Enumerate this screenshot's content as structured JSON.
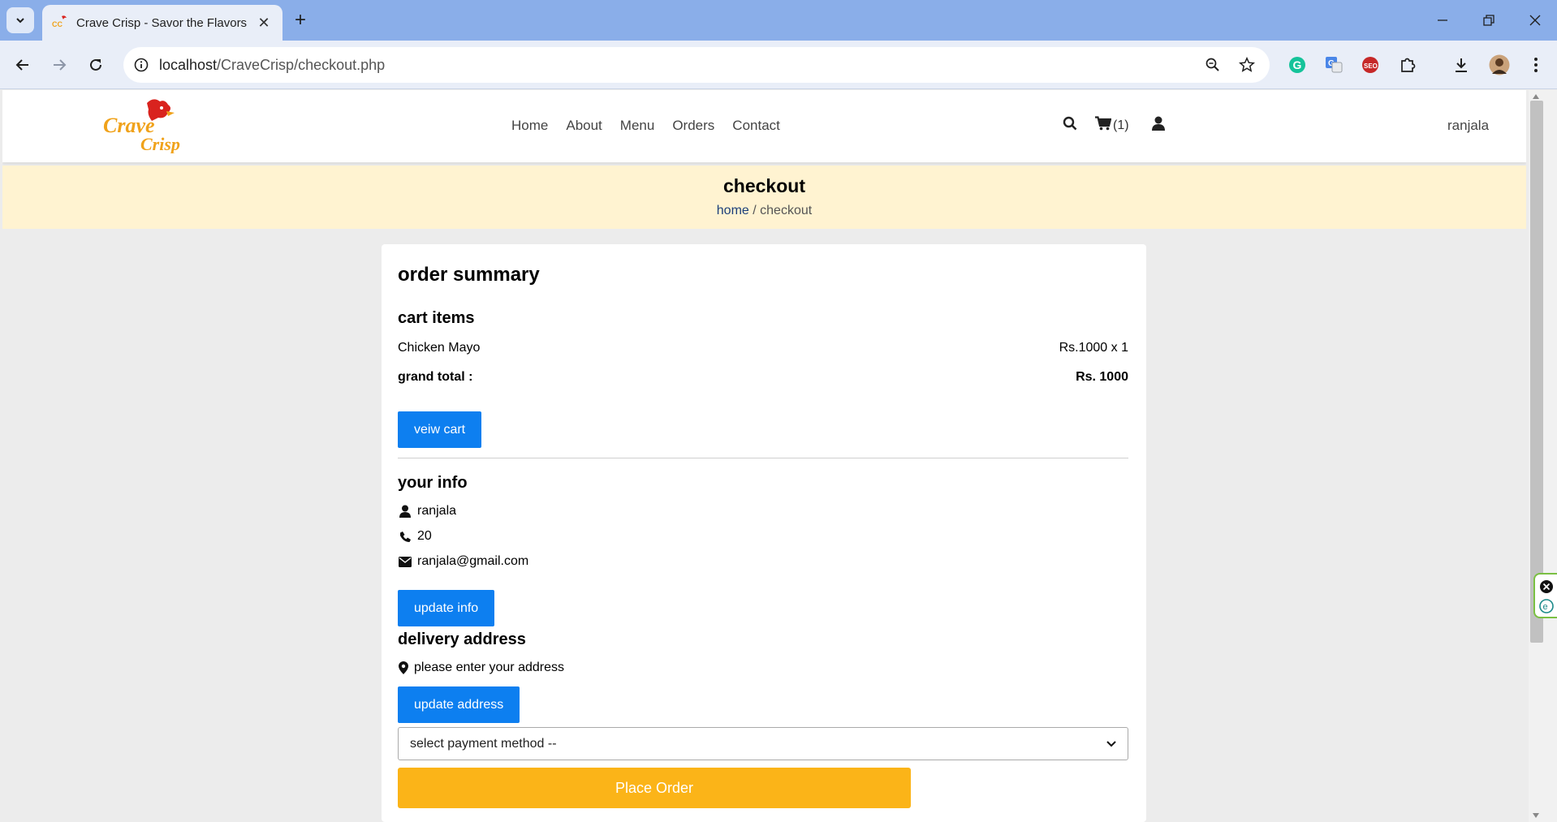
{
  "browser": {
    "tab_title": "Crave Crisp - Savor the Flavors,",
    "url_host": "localhost",
    "url_path": "/CraveCrisp/checkout.php"
  },
  "site": {
    "logo_text_top": "Crave",
    "logo_text_bottom": "Crisp",
    "nav": [
      "Home",
      "About",
      "Menu",
      "Orders",
      "Contact"
    ],
    "cart_count": "(1)",
    "user_name": "ranjala"
  },
  "banner": {
    "title": "checkout",
    "crumb_home": "home",
    "crumb_sep": " / ",
    "crumb_current": "checkout"
  },
  "summary": {
    "title": "order summary",
    "cart_title": "cart items",
    "item_name": "Chicken Mayo",
    "item_price": "Rs.1000 x 1",
    "grand_label": "grand total :",
    "grand_value": "Rs. 1000",
    "view_cart": "veiw cart",
    "info_title": "your info",
    "info_name": "ranjala",
    "info_phone": "20",
    "info_email": "ranjala@gmail.com",
    "update_info": "update info",
    "address_title": "delivery address",
    "address_text": "please enter your address",
    "update_address": "update address",
    "payment_select": "select payment method --",
    "place_order": "Place Order"
  },
  "colors": {
    "primary_button": "#0d7ff0",
    "place_order": "#fbb418",
    "banner_bg": "#fff3d1"
  }
}
